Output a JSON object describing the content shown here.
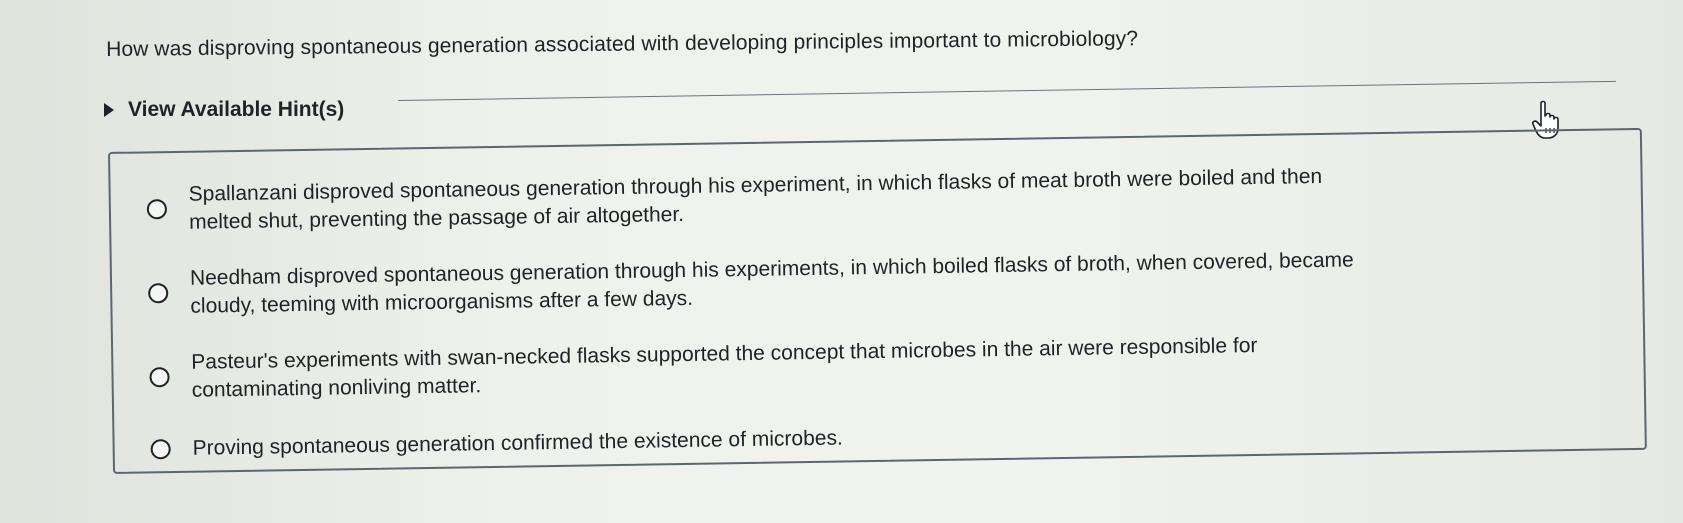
{
  "question": "How was disproving spontaneous generation associated with developing principles important to microbiology?",
  "hint": {
    "label": "View Available Hint(s)"
  },
  "options": [
    {
      "line1": "Spallanzani disproved spontaneous generation through his experiment, in which flasks of meat broth were boiled and then",
      "line2": "melted shut, preventing the passage of air altogether."
    },
    {
      "line1": "Needham disproved spontaneous generation through his experiments, in which boiled flasks of broth, when covered, became",
      "line2": "cloudy, teeming with microorganisms after a few days."
    },
    {
      "line1": "Pasteur's experiments with swan-necked flasks supported the concept that microbes in the air were responsible for",
      "line2": "contaminating nonliving matter."
    },
    {
      "line1": "Proving spontaneous generation confirmed the existence of microbes.",
      "line2": ""
    }
  ],
  "icons": {
    "cursor": "hand-pointer-icon",
    "caret": "caret-right-icon"
  }
}
